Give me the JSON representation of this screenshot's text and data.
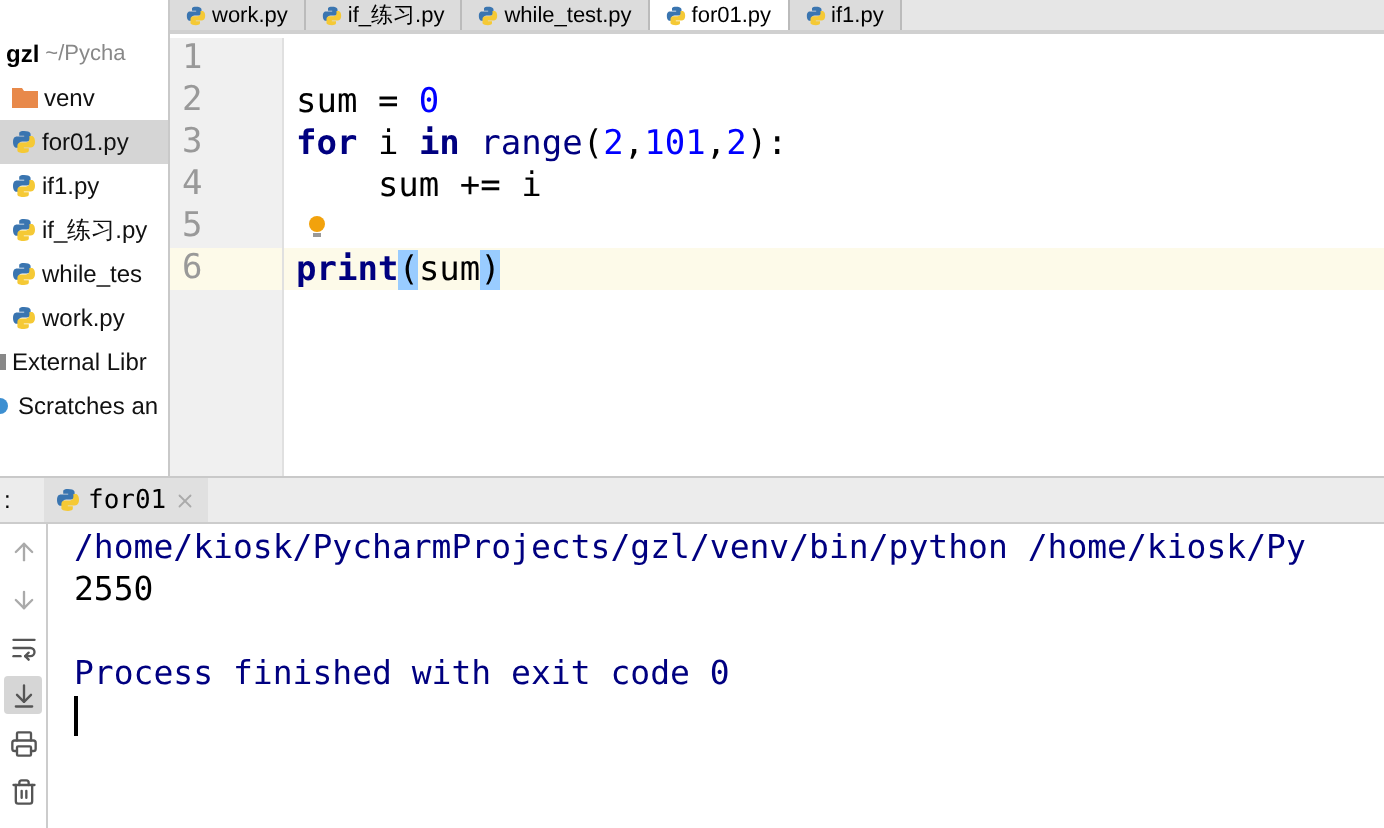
{
  "editor_tabs": [
    {
      "label": "work.py",
      "selected": false
    },
    {
      "label": "if_练习.py",
      "selected": false
    },
    {
      "label": "while_test.py",
      "selected": false
    },
    {
      "label": "for01.py",
      "selected": true
    },
    {
      "label": "if1.py",
      "selected": false
    }
  ],
  "project": {
    "root": "gzl",
    "root_path": "~/Pycha",
    "items": [
      {
        "label": "venv",
        "kind": "folder",
        "selected": false
      },
      {
        "label": "for01.py",
        "kind": "python",
        "selected": true
      },
      {
        "label": "if1.py",
        "kind": "python",
        "selected": false
      },
      {
        "label": "if_练习.py",
        "kind": "python",
        "selected": false
      },
      {
        "label": "while_tes",
        "kind": "python",
        "selected": false
      },
      {
        "label": "work.py",
        "kind": "python",
        "selected": false
      },
      {
        "label": "External Libr",
        "kind": "library",
        "selected": false
      },
      {
        "label": "Scratches an",
        "kind": "scratches",
        "selected": false
      }
    ]
  },
  "editor": {
    "lines": [
      {
        "number": "1",
        "current": false,
        "kind": "empty"
      },
      {
        "number": "2",
        "current": false,
        "kind": "code",
        "tokens": [
          {
            "text": "sum = ",
            "kind": "plain"
          },
          {
            "text": "0",
            "kind": "number"
          }
        ]
      },
      {
        "number": "3",
        "current": false,
        "kind": "code",
        "tokens": [
          {
            "text": "for",
            "kind": "keyword"
          },
          {
            "text": " i ",
            "kind": "plain"
          },
          {
            "text": "in",
            "kind": "keyword"
          },
          {
            "text": " range",
            "kind": "builtin"
          },
          {
            "text": "(",
            "kind": "plain"
          },
          {
            "text": "2",
            "kind": "number"
          },
          {
            "text": ",",
            "kind": "plain"
          },
          {
            "text": "101",
            "kind": "number"
          },
          {
            "text": ",",
            "kind": "plain"
          },
          {
            "text": "2",
            "kind": "number"
          },
          {
            "text": "):",
            "kind": "plain"
          }
        ]
      },
      {
        "number": "4",
        "current": false,
        "kind": "code",
        "tokens": [
          {
            "text": "    sum += i",
            "kind": "plain"
          }
        ]
      },
      {
        "number": "5",
        "current": false,
        "kind": "bulb"
      },
      {
        "number": "6",
        "current": true,
        "kind": "code",
        "tokens": [
          {
            "text": "print",
            "kind": "keyword"
          },
          {
            "text": "(",
            "kind": "match"
          },
          {
            "text": "sum",
            "kind": "plain"
          },
          {
            "text": ")",
            "kind": "match"
          }
        ]
      }
    ]
  },
  "run_panel": {
    "label": ":",
    "tab": "for01",
    "tools": [
      {
        "kind": "up",
        "selected": false
      },
      {
        "kind": "down",
        "selected": false
      },
      {
        "kind": "wrap",
        "selected": false
      },
      {
        "kind": "scroll",
        "selected": true
      },
      {
        "kind": "print",
        "selected": false
      },
      {
        "kind": "trash",
        "selected": false
      }
    ],
    "console": [
      {
        "text": "/home/kiosk/PycharmProjects/gzl/venv/bin/python /home/kiosk/Py",
        "kind": "system"
      },
      {
        "text": "2550",
        "kind": "output"
      },
      {
        "kind": "blank"
      },
      {
        "text": "Process finished with exit code 0",
        "kind": "system"
      }
    ]
  }
}
